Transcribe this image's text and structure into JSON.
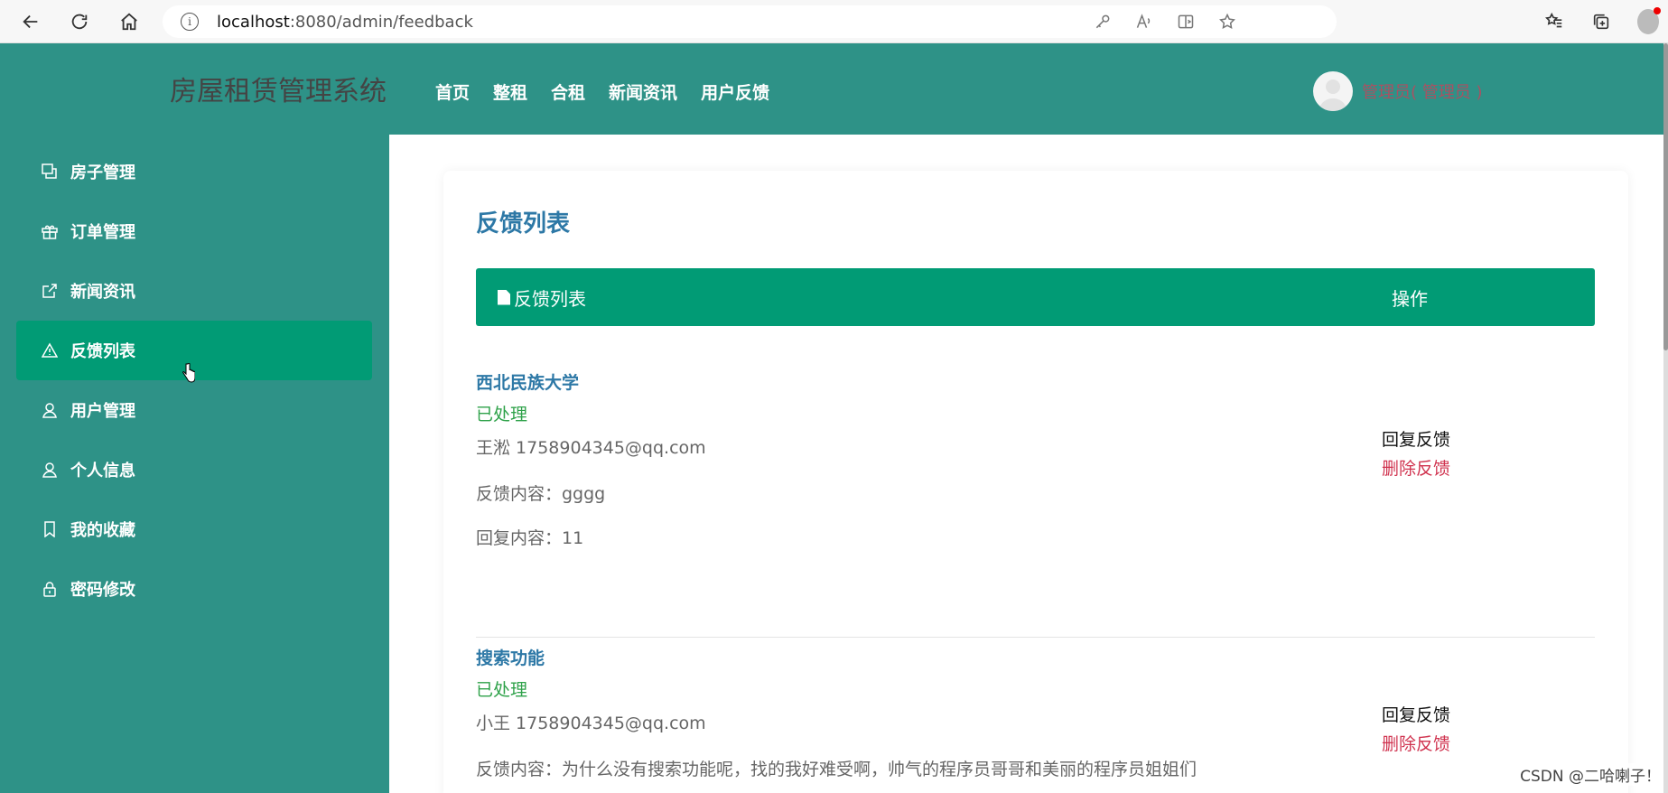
{
  "browser": {
    "url_host": "localhost",
    "url_path": ":8080/admin/feedback"
  },
  "header": {
    "logo": "房屋租赁管理系统",
    "nav": [
      "首页",
      "整租",
      "合租",
      "新闻资讯",
      "用户反馈"
    ],
    "user_name": "管理员( 管理员 )"
  },
  "sidebar": {
    "items": [
      {
        "label": "房子管理",
        "icon": "house-copy-icon"
      },
      {
        "label": "订单管理",
        "icon": "gift-icon"
      },
      {
        "label": "新闻资讯",
        "icon": "external-link-icon"
      },
      {
        "label": "反馈列表",
        "icon": "warning-icon",
        "active": true
      },
      {
        "label": "用户管理",
        "icon": "user-icon"
      },
      {
        "label": "个人信息",
        "icon": "user-icon"
      },
      {
        "label": "我的收藏",
        "icon": "bookmark-icon"
      },
      {
        "label": "密码修改",
        "icon": "lock-icon"
      }
    ]
  },
  "main": {
    "title": "反馈列表",
    "table_head": {
      "title": "反馈列表",
      "operation": "操作"
    },
    "feedbacks": [
      {
        "title": "西北民族大学",
        "status": "已处理",
        "user": "王淞 1758904345@qq.com",
        "content": "反馈内容：gggg",
        "reply": "回复内容：11",
        "reply_btn": "回复反馈",
        "delete_btn": "删除反馈"
      },
      {
        "title": "搜索功能",
        "status": "已处理",
        "user": "小王 1758904345@qq.com",
        "content": "反馈内容：为什么没有搜索功能呢，找的我好难受啊，帅气的程序员哥哥和美丽的程序员姐姐们",
        "reply_btn": "回复反馈",
        "delete_btn": "删除反馈"
      }
    ]
  },
  "watermark": "CSDN @二哈喇子！",
  "colors": {
    "header_bg": "#2e9287",
    "active_item": "#019b75",
    "title_blue": "#2d78a6",
    "status_green": "#2fa24a",
    "delete_red": "#d0334f"
  }
}
